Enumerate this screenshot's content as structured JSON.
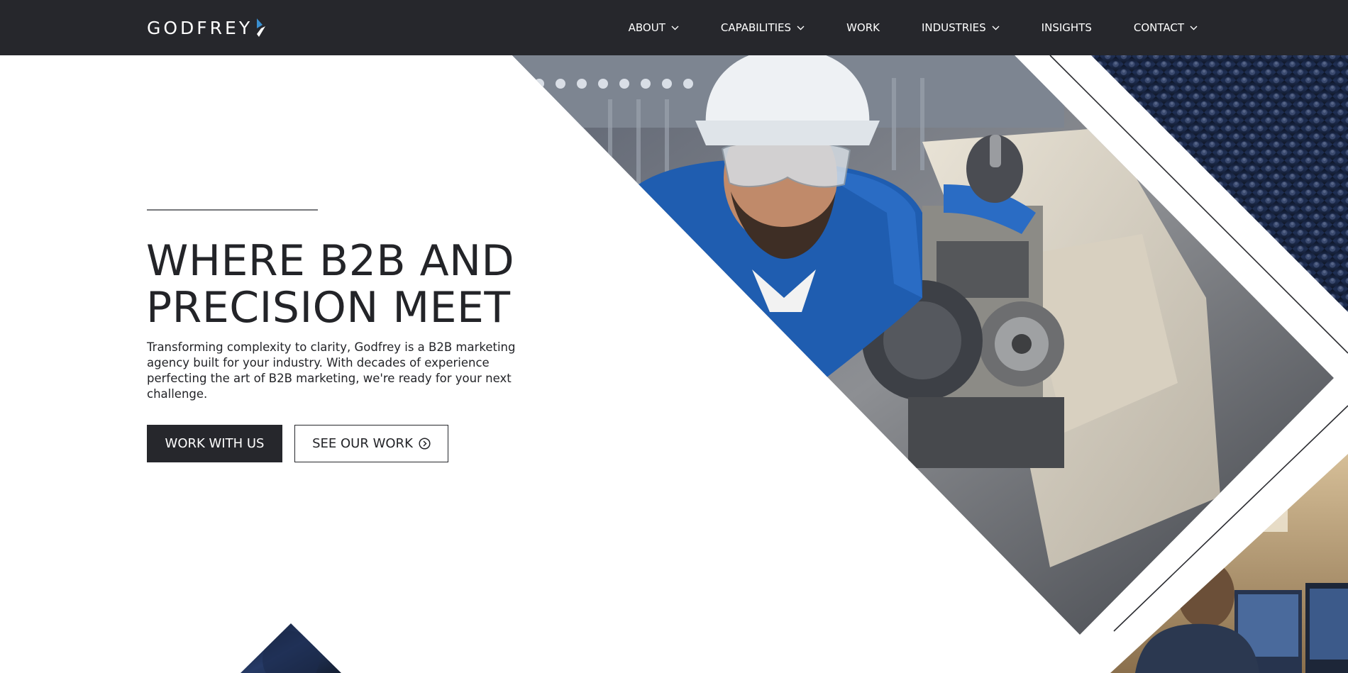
{
  "brand": {
    "name": "GODFREY",
    "accent": "#3a8fd0",
    "dark": "#26272c"
  },
  "nav": {
    "items": [
      {
        "label": "ABOUT",
        "has_dropdown": true
      },
      {
        "label": "CAPABILITIES",
        "has_dropdown": true
      },
      {
        "label": "WORK",
        "has_dropdown": false
      },
      {
        "label": "INDUSTRIES",
        "has_dropdown": true
      },
      {
        "label": "INSIGHTS",
        "has_dropdown": false
      },
      {
        "label": "CONTACT",
        "has_dropdown": true
      }
    ]
  },
  "hero": {
    "title_line1": "WHERE B2B AND",
    "title_line2": "PRECISION MEET",
    "description": "Transforming complexity to clarity, Godfrey is a B2B marketing agency built for your industry. With decades of experience perfecting the art of B2B marketing, we're ready for your next challenge.",
    "primary_button": "WORK WITH US",
    "secondary_button": "SEE OUR WORK",
    "secondary_button_icon": "arrow-circle-right-icon"
  },
  "images": [
    {
      "name": "worker-lathe-photo",
      "subject": "industrial worker at lathe"
    },
    {
      "name": "textured-dark-photo",
      "subject": "dark textured surface"
    },
    {
      "name": "control-room-photo",
      "subject": "engineer at monitors"
    },
    {
      "name": "bottom-dark-diamond",
      "subject": "dark diamond"
    }
  ]
}
